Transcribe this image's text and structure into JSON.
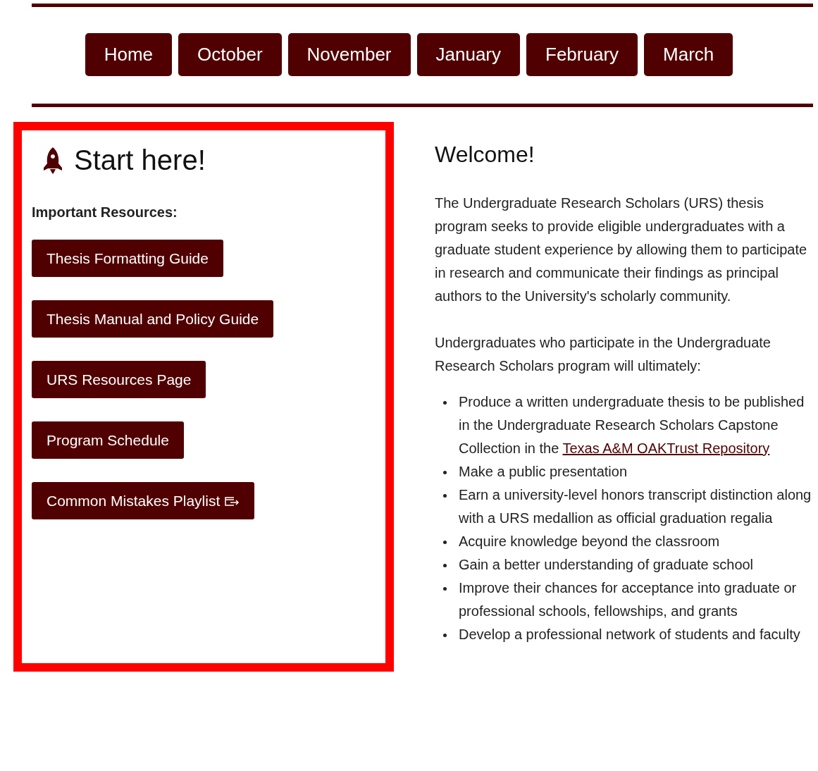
{
  "nav": [
    {
      "label": "Home"
    },
    {
      "label": "October"
    },
    {
      "label": "November"
    },
    {
      "label": "January"
    },
    {
      "label": "February"
    },
    {
      "label": "March"
    }
  ],
  "start": {
    "title": "Start here!",
    "subtitle": "Important Resources:",
    "buttons": [
      {
        "label": "Thesis Formatting Guide",
        "external": false
      },
      {
        "label": "Thesis Manual and Policy Guide",
        "external": false
      },
      {
        "label": "URS Resources Page",
        "external": false
      },
      {
        "label": "Program Schedule",
        "external": false
      },
      {
        "label": "Common Mistakes Playlist",
        "external": true
      }
    ]
  },
  "welcome": {
    "title": "Welcome!",
    "paragraphs": [
      "The Undergraduate Research Scholars (URS) thesis program seeks to provide eligible undergraduates with a graduate student experience by allowing them to participate in research and communicate their findings as principal authors to the University's scholarly community.",
      "Undergraduates who participate in the Undergraduate Research Scholars program will ultimately:"
    ],
    "list": [
      {
        "text": "Produce a written undergraduate thesis to be published in the Undergraduate Research Scholars Capstone Collection in the ",
        "link": "Texas A&M OAKTrust Repository"
      },
      {
        "text": "Make a public presentation"
      },
      {
        "text": "Earn a university-level honors transcript distinction along with a URS medallion as official graduation regalia"
      },
      {
        "text": "Acquire knowledge beyond the classroom"
      },
      {
        "text": "Gain a better understanding of graduate school"
      },
      {
        "text": "Improve their chances for acceptance into graduate or professional schools, fellowships, and grants"
      },
      {
        "text": "Develop a professional network of students and faculty"
      }
    ]
  }
}
